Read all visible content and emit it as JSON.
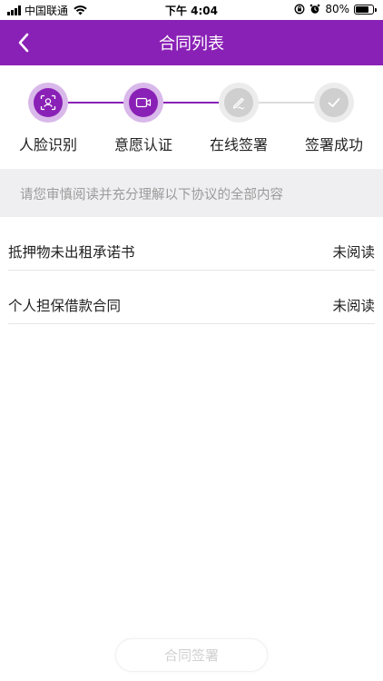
{
  "status_bar": {
    "carrier": "中国联通",
    "time": "下午 4:04",
    "battery_text": "80%",
    "battery_level": 0.8
  },
  "nav": {
    "title": "合同列表",
    "back_icon": "chevron-left-icon"
  },
  "stepper": {
    "active_color": "#8a21b6",
    "steps": [
      {
        "label": "人脸识别",
        "icon": "face-scan-icon",
        "state": "completed"
      },
      {
        "label": "意愿认证",
        "icon": "video-camera-icon",
        "state": "active"
      },
      {
        "label": "在线签署",
        "icon": "pen-sign-icon",
        "state": "pending"
      },
      {
        "label": "签署成功",
        "icon": "check-icon",
        "state": "pending"
      }
    ]
  },
  "notice": {
    "text": "请您审慎阅读并充分理解以下协议的全部内容"
  },
  "contracts": [
    {
      "name": "抵押物未出租承诺书",
      "status": "未阅读"
    },
    {
      "name": "个人担保借款合同",
      "status": "未阅读"
    }
  ],
  "sign_button": {
    "label": "合同签署"
  },
  "colors": {
    "brand": "#8a21b6",
    "notice_bg": "#efeff1",
    "inactive_step": "#cfcfcf"
  }
}
